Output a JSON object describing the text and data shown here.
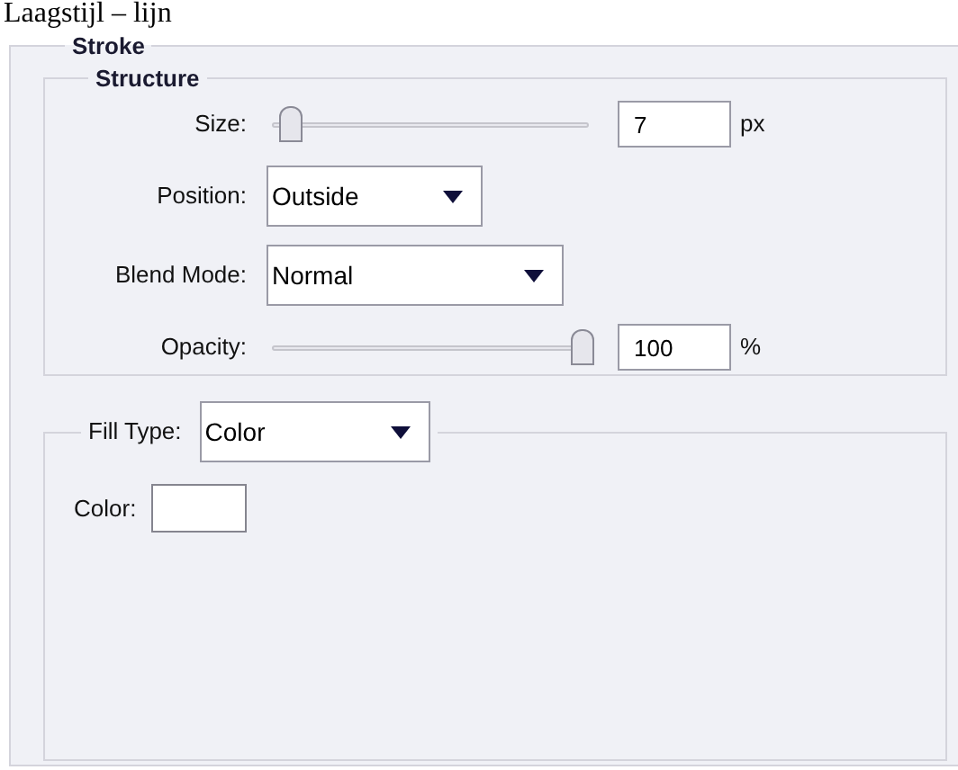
{
  "page_title": "Laagstijl – lijn",
  "group": {
    "title": "Stroke",
    "structure": {
      "title": "Structure",
      "rows": [
        {
          "kind": "slider",
          "label": "Size:",
          "level": 0.04,
          "value": "7",
          "unit": "px"
        },
        {
          "kind": "dropdown",
          "label": "Position:",
          "value": "Outside"
        },
        {
          "kind": "dropdown",
          "label": "Blend Mode:",
          "value": "Normal"
        },
        {
          "kind": "slider",
          "label": "Opacity:",
          "level": 1.0,
          "value": "100",
          "unit": "%"
        }
      ]
    },
    "fill": {
      "label": "Fill Type:",
      "value": "Color",
      "color_label": "Color:",
      "color": "#ffffff"
    }
  }
}
